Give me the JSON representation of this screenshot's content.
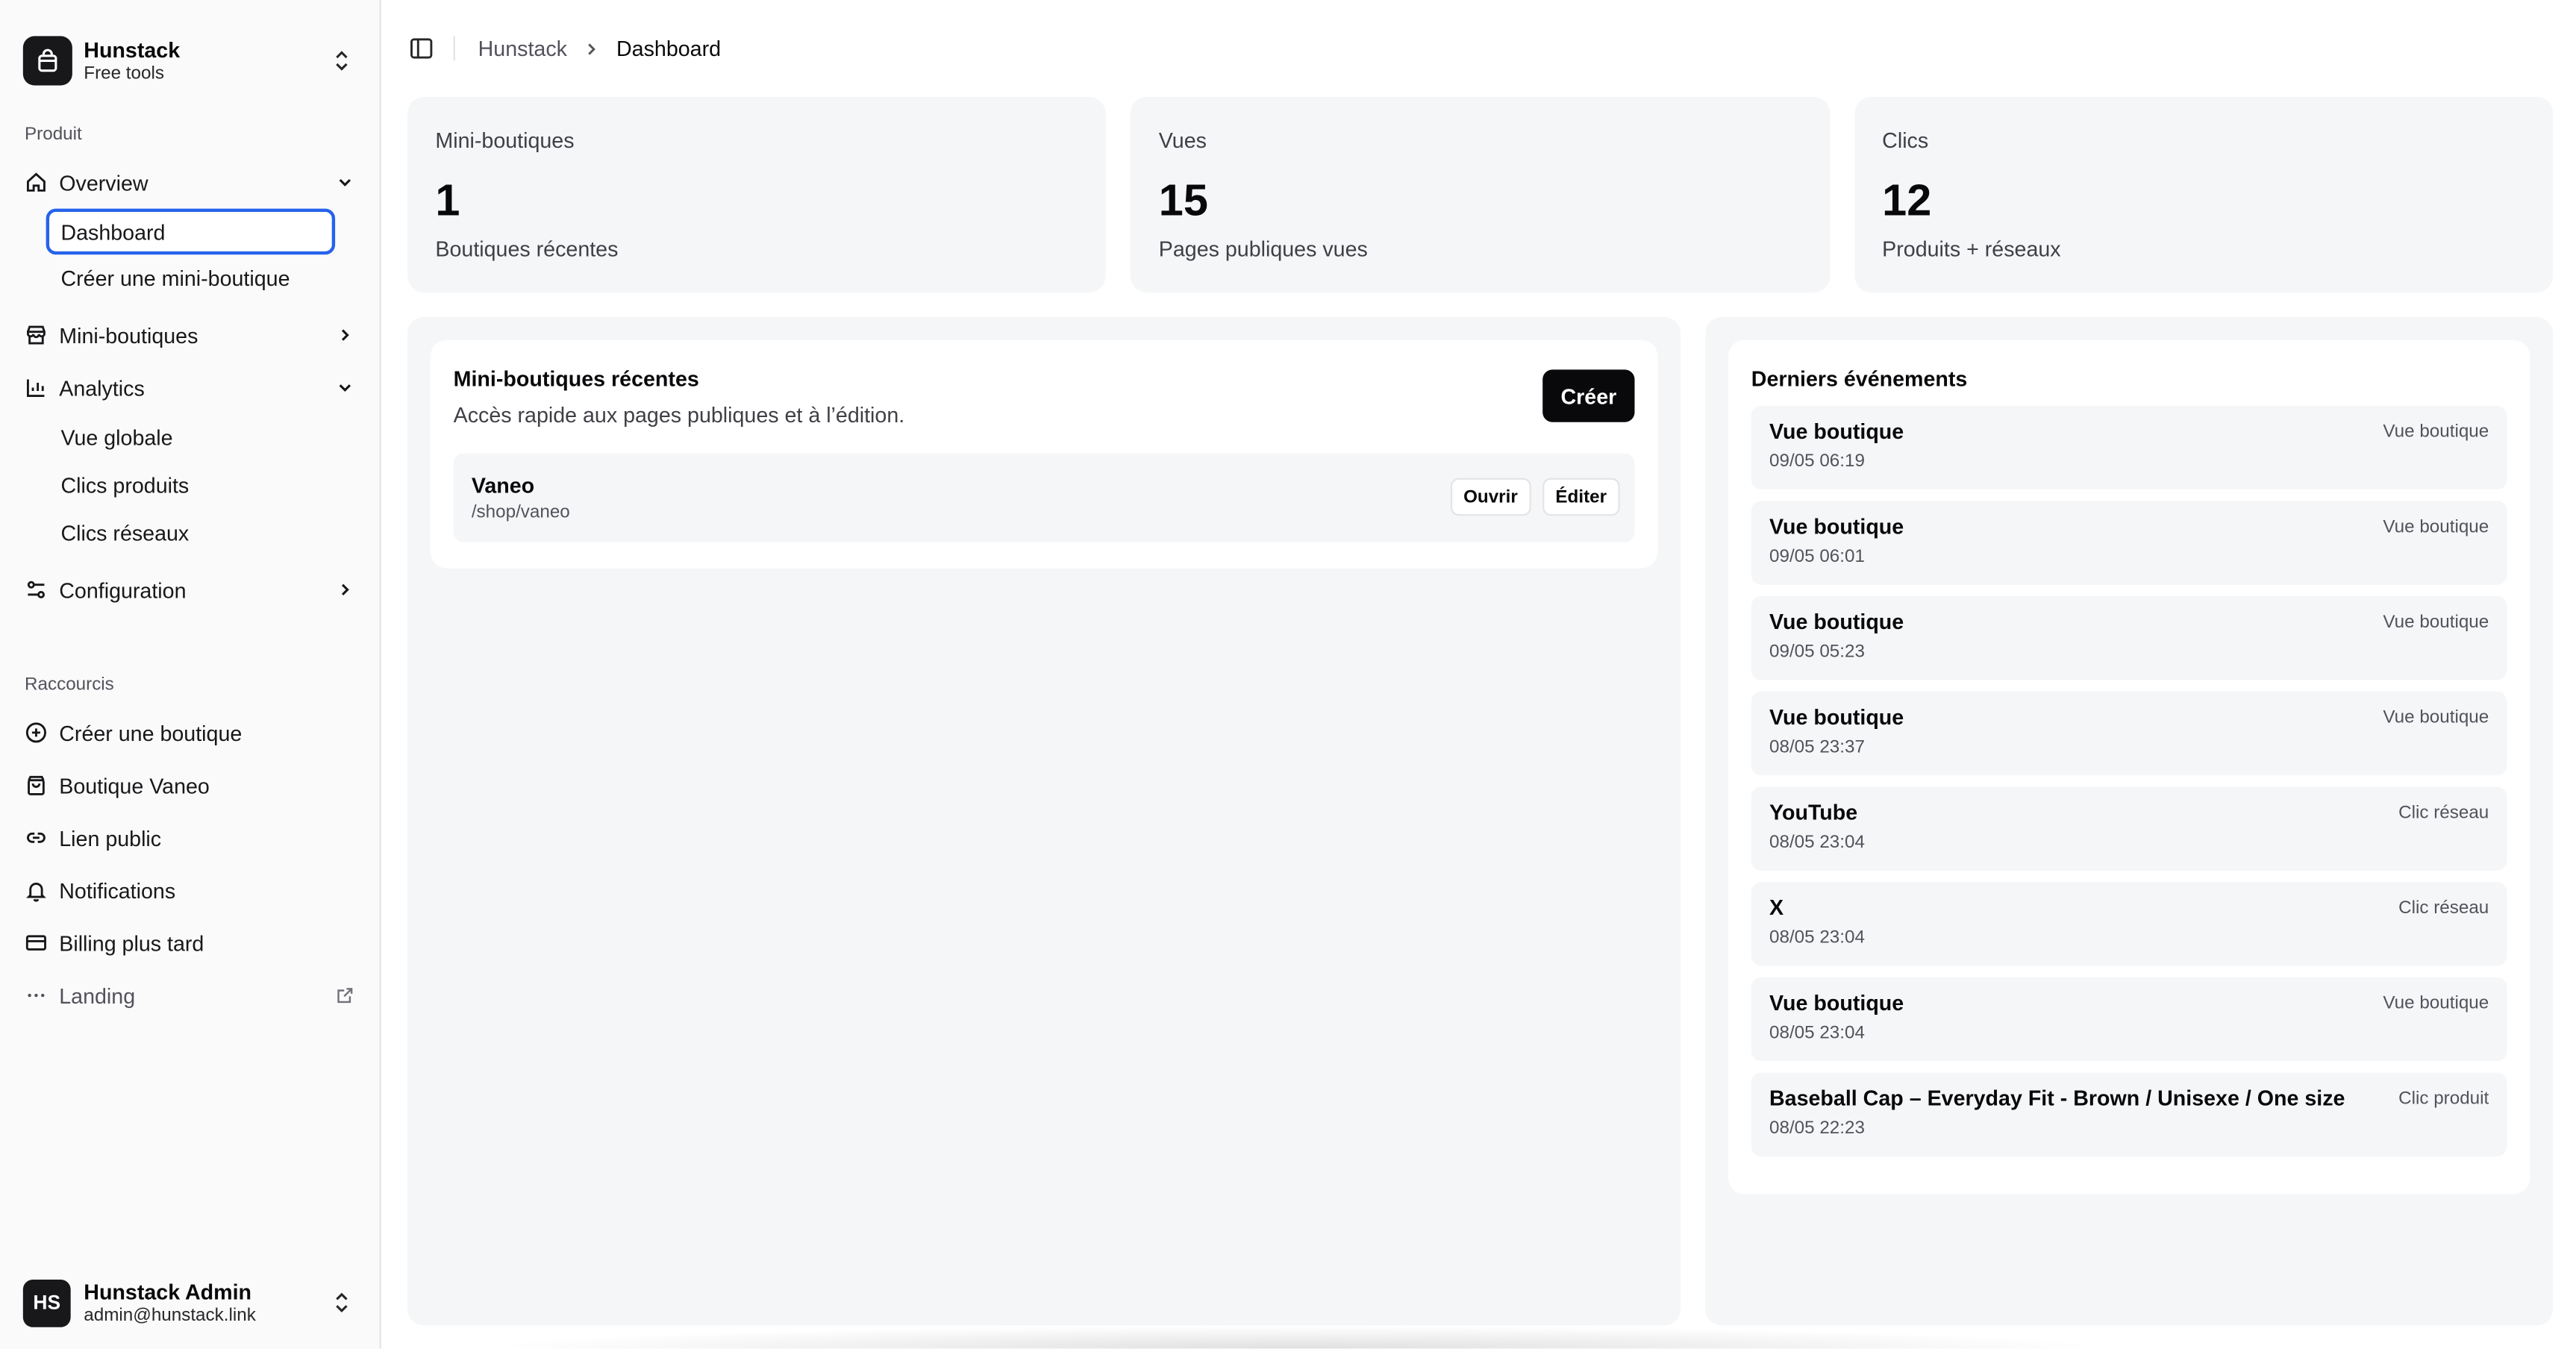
{
  "brand": {
    "name": "Hunstack",
    "subtitle": "Free tools"
  },
  "sidebar": {
    "produit_label": "Produit",
    "overview": {
      "label": "Overview",
      "items": [
        "Dashboard",
        "Créer une mini-boutique"
      ]
    },
    "mini_boutiques": {
      "label": "Mini-boutiques"
    },
    "analytics": {
      "label": "Analytics",
      "items": [
        "Vue globale",
        "Clics produits",
        "Clics réseaux"
      ]
    },
    "configuration": {
      "label": "Configuration"
    },
    "raccourcis_label": "Raccourcis",
    "shortcuts": [
      "Créer une boutique",
      "Boutique Vaneo",
      "Lien public",
      "Notifications",
      "Billing plus tard",
      "Landing"
    ]
  },
  "user": {
    "initials": "HS",
    "name": "Hunstack Admin",
    "email": "admin@hunstack.link"
  },
  "breadcrumb": {
    "root": "Hunstack",
    "current": "Dashboard"
  },
  "stats": [
    {
      "title": "Mini-boutiques",
      "value": "1",
      "desc": "Boutiques récentes"
    },
    {
      "title": "Vues",
      "value": "15",
      "desc": "Pages publiques vues"
    },
    {
      "title": "Clics",
      "value": "12",
      "desc": "Produits + réseaux"
    }
  ],
  "recent": {
    "title": "Mini-boutiques récentes",
    "subtitle": "Accès rapide aux pages publiques et à l’édition.",
    "create_label": "Créer",
    "shop": {
      "name": "Vaneo",
      "path": "/shop/vaneo",
      "open_label": "Ouvrir",
      "edit_label": "Éditer"
    }
  },
  "events": {
    "title": "Derniers événements",
    "items": [
      {
        "title": "Vue boutique",
        "time": "09/05 06:19",
        "type": "Vue boutique"
      },
      {
        "title": "Vue boutique",
        "time": "09/05 06:01",
        "type": "Vue boutique"
      },
      {
        "title": "Vue boutique",
        "time": "09/05 05:23",
        "type": "Vue boutique"
      },
      {
        "title": "Vue boutique",
        "time": "08/05 23:37",
        "type": "Vue boutique"
      },
      {
        "title": "YouTube",
        "time": "08/05 23:04",
        "type": "Clic réseau"
      },
      {
        "title": "X",
        "time": "08/05 23:04",
        "type": "Clic réseau"
      },
      {
        "title": "Vue boutique",
        "time": "08/05 23:04",
        "type": "Vue boutique"
      },
      {
        "title": "Baseball Cap – Everyday Fit - Brown / Unisexe / One size",
        "time": "08/05 22:23",
        "type": "Clic produit"
      }
    ]
  },
  "colors": {
    "accent": "#2563eb",
    "dark": "#09090b",
    "panel": "#f5f6f8"
  }
}
